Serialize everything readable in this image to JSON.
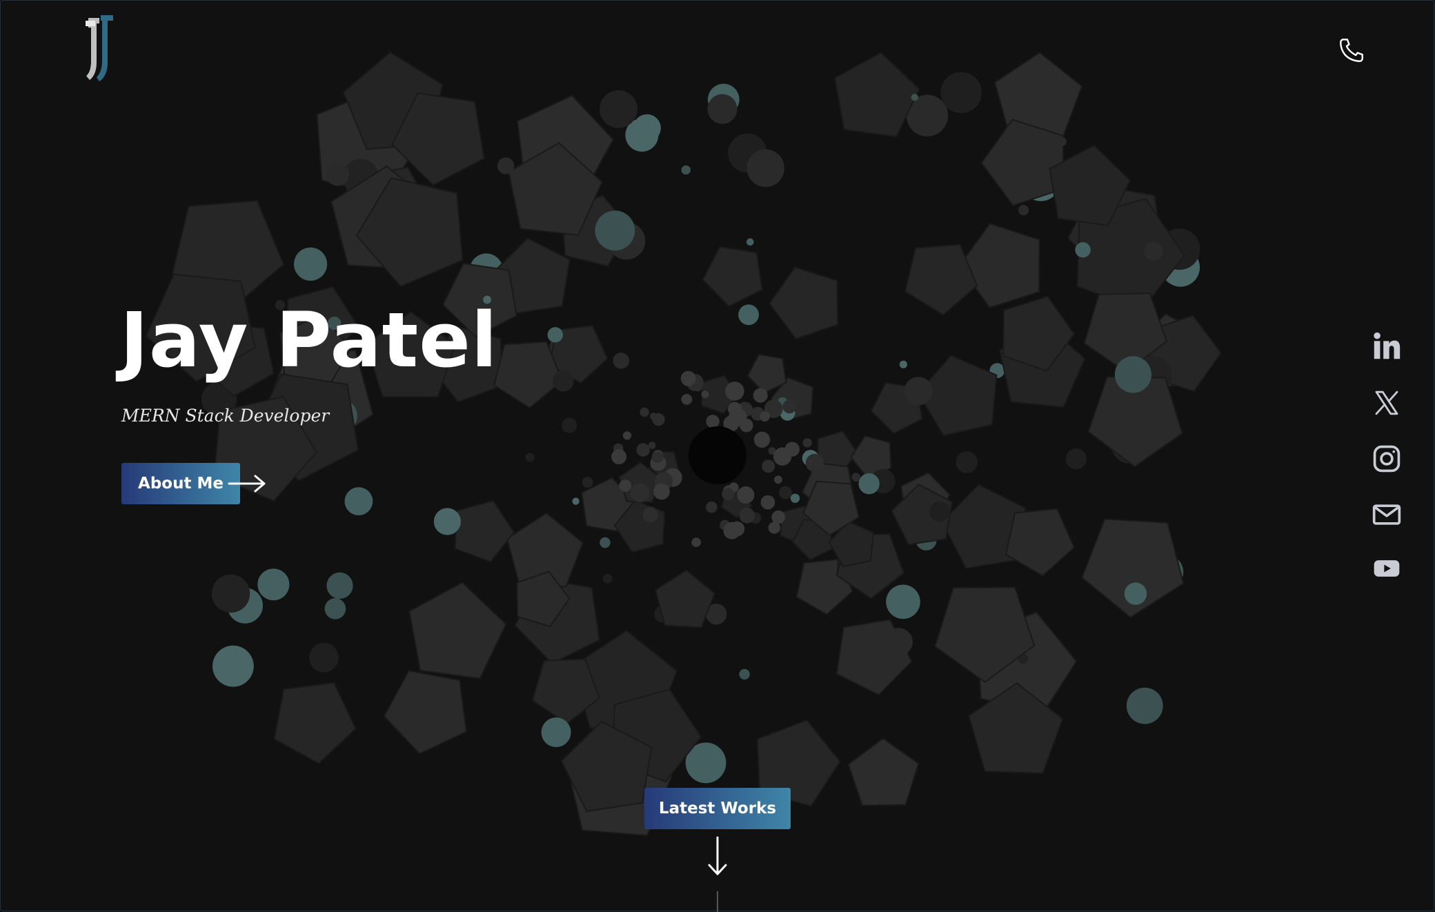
{
  "header": {
    "logo_text": "JJ",
    "phone_icon": "phone-icon"
  },
  "hero": {
    "name": "Jay Patel",
    "role": "MERN Stack Developer",
    "about_button": "About Me",
    "about_arrow_icon": "arrow-right-icon"
  },
  "social": [
    {
      "name": "linkedin-icon"
    },
    {
      "name": "x-twitter-icon"
    },
    {
      "name": "instagram-icon"
    },
    {
      "name": "mail-icon"
    },
    {
      "name": "youtube-icon"
    }
  ],
  "works": {
    "button": "Latest Works",
    "arrow_icon": "arrow-down-icon"
  },
  "colors": {
    "background": "#111111",
    "accent_start": "#263a78",
    "accent_end": "#3f86a8",
    "shape_fill": "#282828",
    "bubble_teal": "#3f5858",
    "icon_gray": "#c9ccd4"
  }
}
